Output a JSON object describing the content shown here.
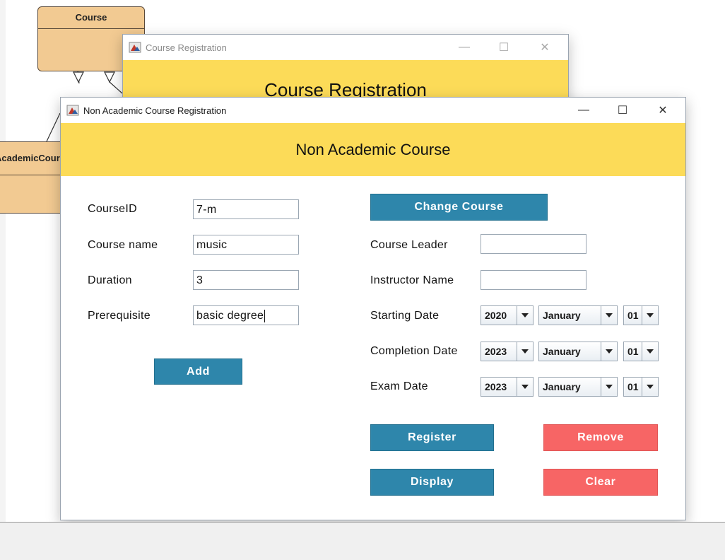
{
  "uml": {
    "course_box_title": "Course",
    "academic_box_title": "AcademicCourse"
  },
  "back_window": {
    "title": "Course Registration",
    "header": "Course Registration",
    "controls": {
      "minimize": "—",
      "maximize": "☐",
      "close": "✕"
    }
  },
  "front_window": {
    "title": "Non Academic Course Registration",
    "header": "Non Academic Course",
    "controls": {
      "minimize": "—",
      "maximize": "☐",
      "close": "✕"
    }
  },
  "form": {
    "course_id": {
      "label": "CourseID",
      "value": "7-m"
    },
    "course_name": {
      "label": "Course name",
      "value": "music"
    },
    "duration": {
      "label": "Duration",
      "value": "3"
    },
    "prerequisite": {
      "label": "Prerequisite",
      "value": "basic degree"
    },
    "add_button": "Add",
    "change_course_button": "Change Course",
    "course_leader": {
      "label": "Course Leader",
      "value": ""
    },
    "instructor_name": {
      "label": "Instructor Name",
      "value": ""
    },
    "starting_date": {
      "label": "Starting Date",
      "year": "2020",
      "month": "January",
      "day": "01"
    },
    "completion_date": {
      "label": "Completion Date",
      "year": "2023",
      "month": "January",
      "day": "01"
    },
    "exam_date": {
      "label": "Exam Date",
      "year": "2023",
      "month": "January",
      "day": "01"
    },
    "register_button": "Register",
    "remove_button": "Remove",
    "display_button": "Display",
    "clear_button": "Clear"
  },
  "colors": {
    "header_yellow": "#fcdb58",
    "button_blue": "#2e86ab",
    "button_red": "#f76565",
    "uml_fill": "#f2ca92"
  }
}
